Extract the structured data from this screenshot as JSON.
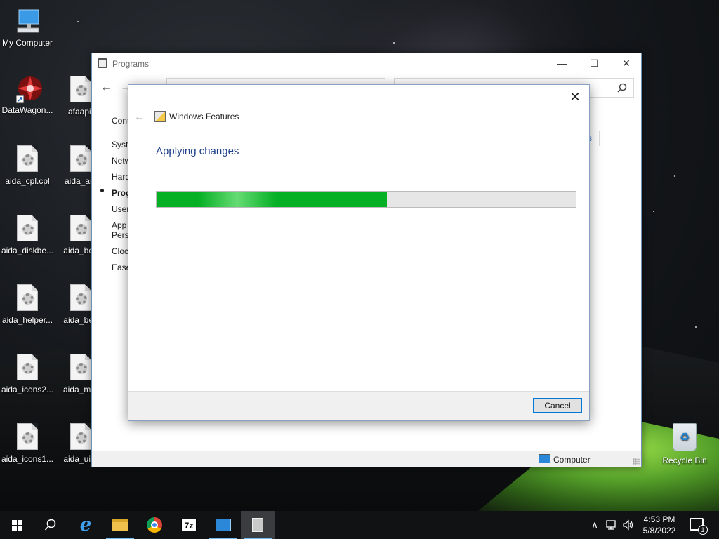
{
  "desktop": {
    "icons": [
      {
        "label": "My Computer",
        "icon": "computer-icon"
      },
      {
        "label": "DataWagon...",
        "icon": "datawagon-icon"
      },
      {
        "label": "afaapi.",
        "icon": "file-gear-icon"
      },
      {
        "label": "aida_cpl.cpl",
        "icon": "file-gear-icon"
      },
      {
        "label": "aida_arc",
        "icon": "file-gear-icon"
      },
      {
        "label": "aida_diskbe...",
        "icon": "file-gear-icon"
      },
      {
        "label": "aida_ben",
        "icon": "file-gear-icon"
      },
      {
        "label": "aida_helper...",
        "icon": "file-gear-icon"
      },
      {
        "label": "aida_ben",
        "icon": "file-gear-icon"
      },
      {
        "label": "aida_icons2...",
        "icon": "file-gear-icon"
      },
      {
        "label": "aida_mor",
        "icon": "file-gear-icon"
      },
      {
        "label": "aida_icons1...",
        "icon": "file-gear-icon"
      },
      {
        "label": "aida_uire",
        "icon": "file-gear-icon"
      }
    ],
    "recycle_bin": {
      "label": "Recycle Bin",
      "icon": "recycle-bin-icon"
    }
  },
  "programs_window": {
    "title": "Programs",
    "buttons": {
      "minimize": "—",
      "maximize": "☐",
      "close": "✕"
    },
    "nav": {
      "back": "←",
      "forward": "→"
    },
    "sidebar": [
      {
        "label": "Cont",
        "active": false
      },
      {
        "label": "Syste",
        "active": false
      },
      {
        "label": "Netw",
        "active": false
      },
      {
        "label": "Hard",
        "active": false
      },
      {
        "label": "Prog",
        "active": true
      },
      {
        "label": "User",
        "active": false
      },
      {
        "label": "App",
        "active": false
      },
      {
        "label": "Pers",
        "active": false
      },
      {
        "label": "Clock",
        "active": false
      },
      {
        "label": "Ease",
        "active": false
      }
    ],
    "right_link": "s",
    "status_bar": {
      "location": "Computer"
    }
  },
  "windows_features": {
    "title": "Windows Features",
    "heading": "Applying changes",
    "progress": {
      "fraction": 0.55,
      "fill_color": "#06b025"
    },
    "close": "✕",
    "back": "←",
    "cancel_label": "Cancel"
  },
  "taskbar": {
    "apps": [
      {
        "name": "start",
        "icon": "windows-logo-icon"
      },
      {
        "name": "search",
        "icon": "search-icon"
      },
      {
        "name": "internet-explorer",
        "icon": "internet-explorer-icon"
      },
      {
        "name": "file-explorer",
        "icon": "folder-icon"
      },
      {
        "name": "chrome",
        "icon": "chrome-icon"
      },
      {
        "name": "7zip",
        "icon": "7zip-icon",
        "text": "7z"
      },
      {
        "name": "control-panel",
        "icon": "control-panel-icon"
      },
      {
        "name": "windows-features",
        "icon": "windows-features-icon"
      }
    ],
    "tray": {
      "chevron": "∧",
      "network": "🖧",
      "volume": "🔊"
    },
    "clock": {
      "time": "4:53 PM",
      "date": "5/8/2022"
    },
    "notifications_count": "1"
  }
}
